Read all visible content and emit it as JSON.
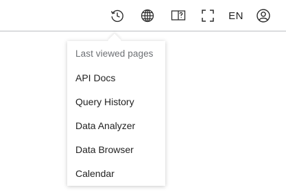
{
  "topbar": {
    "icons": [
      "history-icon",
      "globe-icon",
      "help-book-icon",
      "fullscreen-icon"
    ],
    "language": "EN",
    "user_icon": "user-icon"
  },
  "dropdown": {
    "header": "Last viewed pages",
    "items": [
      {
        "label": "API Docs"
      },
      {
        "label": "Query History"
      },
      {
        "label": "Data Analyzer"
      },
      {
        "label": "Data Browser"
      },
      {
        "label": "Calendar"
      }
    ]
  },
  "colors": {
    "text": "#1f1f1f",
    "muted": "#6c6f73",
    "divider": "#b9bcc0"
  }
}
